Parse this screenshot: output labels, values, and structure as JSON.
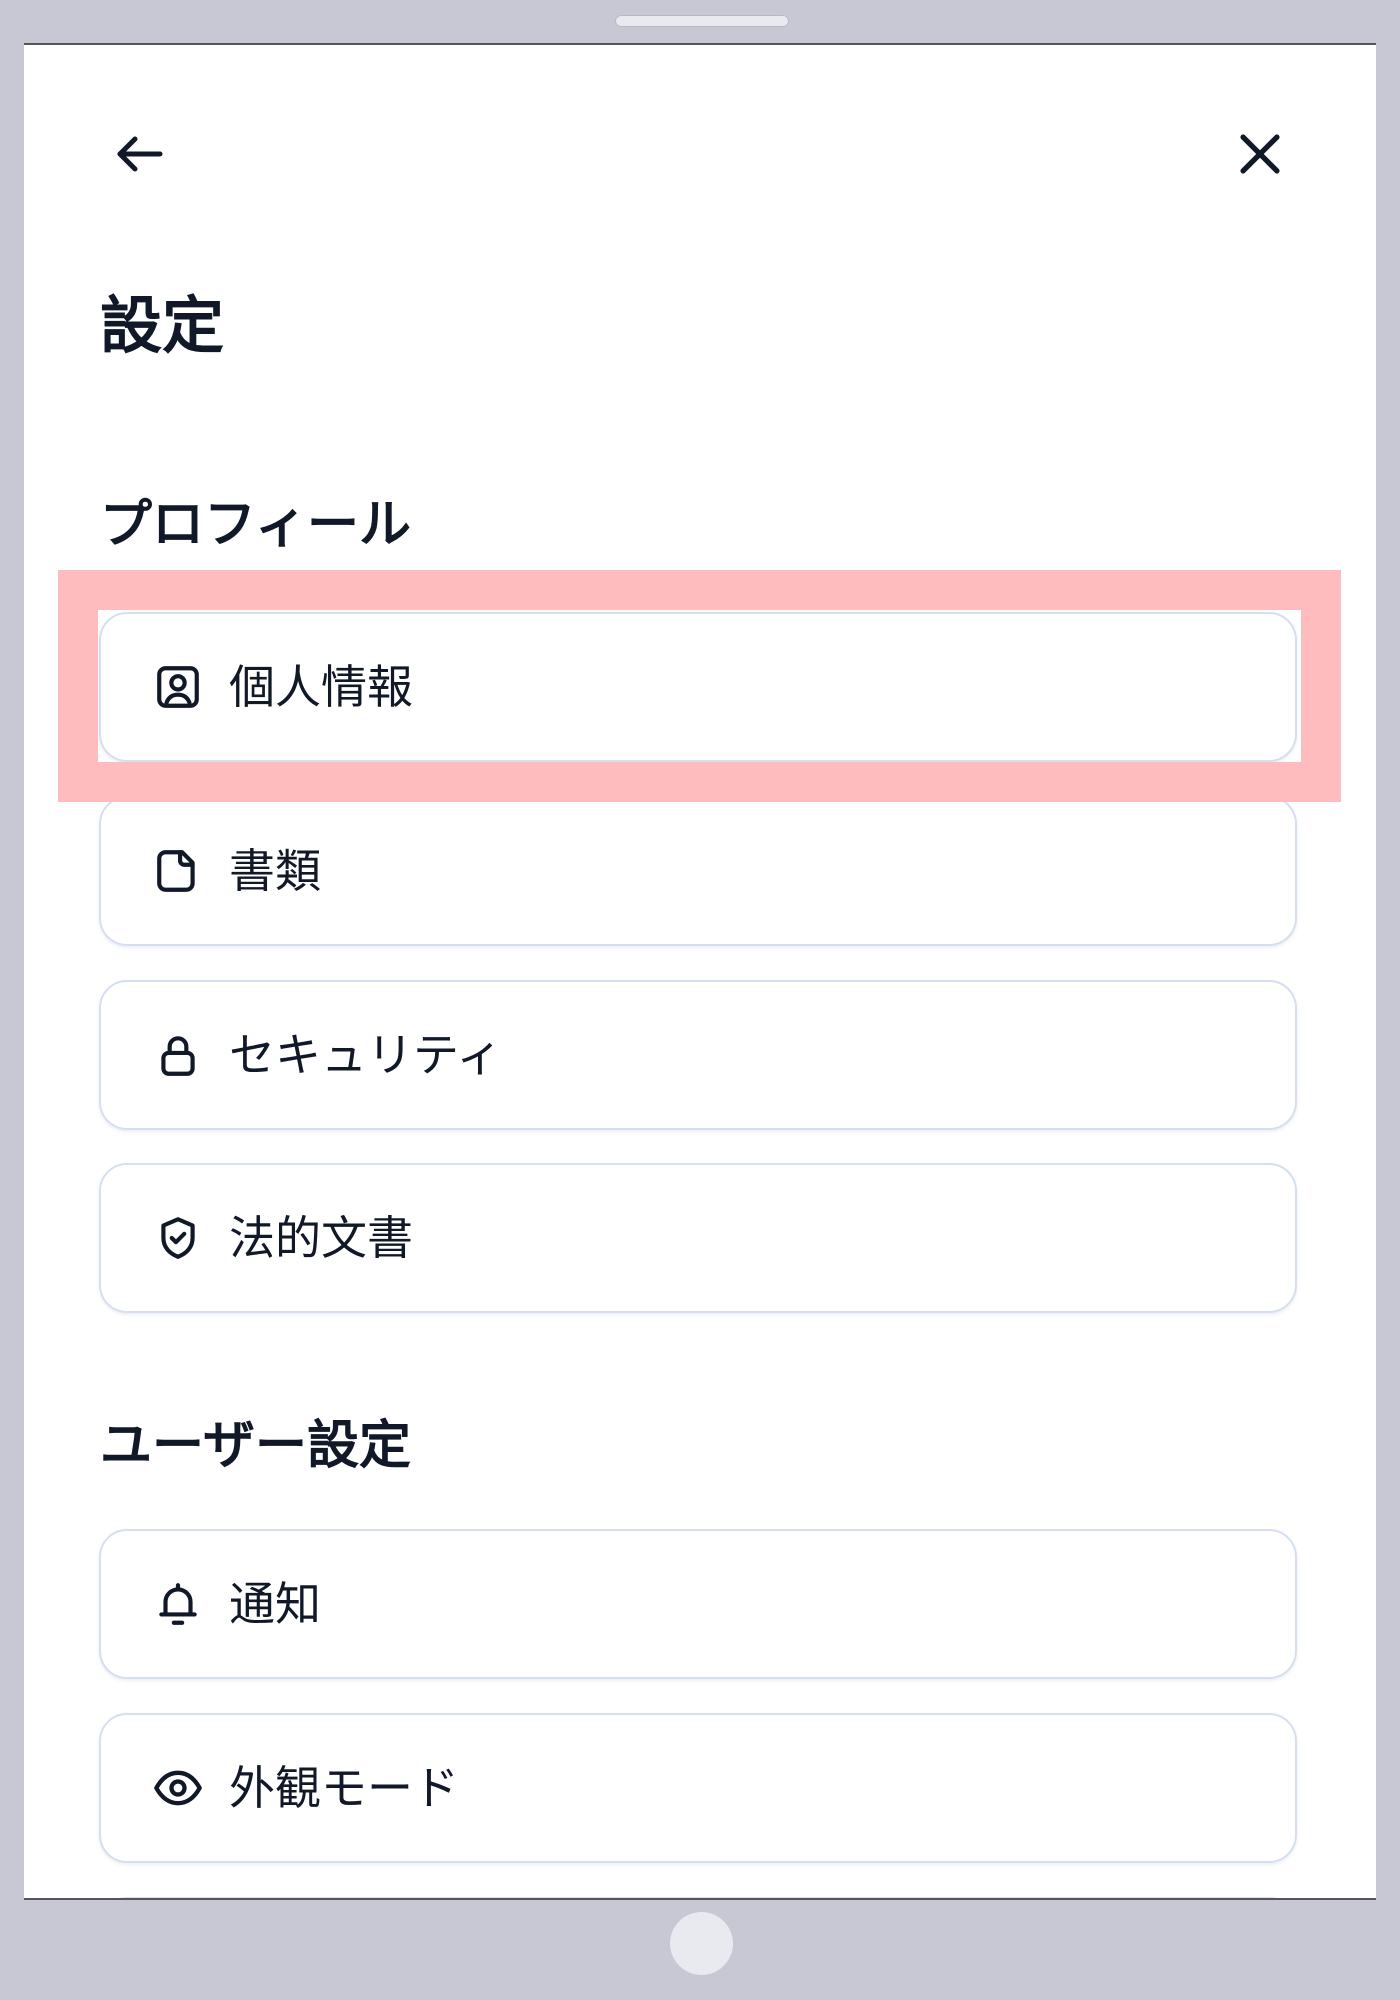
{
  "header": {
    "back_icon": "arrow-left-icon",
    "close_icon": "close-icon",
    "title": "設定"
  },
  "sections": [
    {
      "heading": "プロフィール",
      "items": [
        {
          "label": "個人情報",
          "icon": "user-square-icon",
          "highlighted": true
        },
        {
          "label": "書類",
          "icon": "document-icon"
        },
        {
          "label": "セキュリティ",
          "icon": "lock-icon"
        },
        {
          "label": "法的文書",
          "icon": "shield-check-icon"
        }
      ]
    },
    {
      "heading": "ユーザー設定",
      "items": [
        {
          "label": "通知",
          "icon": "bell-icon"
        },
        {
          "label": "外観モード",
          "icon": "eye-icon"
        }
      ]
    }
  ],
  "colors": {
    "text": "#111827",
    "card_border": "#d6dff0",
    "highlight": "#ffbcbf",
    "device_frame": "#c8c8d4",
    "screen_bg": "#ffffff"
  }
}
